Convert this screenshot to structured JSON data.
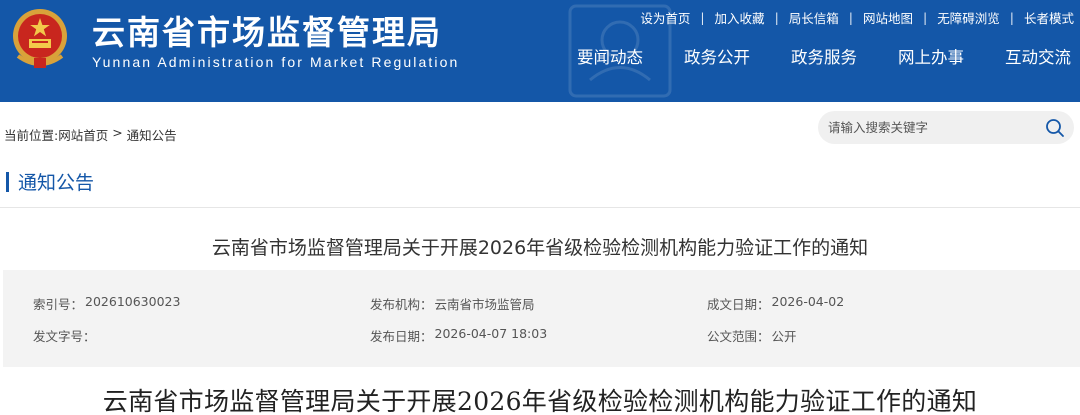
{
  "header": {
    "title": "云南省市场监督管理局",
    "subtitle": "Yunnan Administration for Market Regulation",
    "top_links": [
      "设为首页",
      "加入收藏",
      "局长信箱",
      "网站地图",
      "无障碍浏览",
      "长者模式"
    ],
    "nav": [
      "要闻动态",
      "政务公开",
      "政务服务",
      "网上办事",
      "互动交流"
    ],
    "brand_color": "#1457a8"
  },
  "breadcrumb": {
    "prefix": "当前位置: ",
    "home": "网站首页",
    "separator": " > ",
    "current": "通知公告"
  },
  "search": {
    "placeholder": "请输入搜索关键字",
    "icon": "search-icon"
  },
  "section": {
    "title": "通知公告"
  },
  "article": {
    "title": "云南省市场监督管理局关于开展2026年省级检验检测机构能力验证工作的通知",
    "meta": [
      {
        "label": "索引号：",
        "value": "202610630023"
      },
      {
        "label": "发布机构：",
        "value": "云南省市场监管局"
      },
      {
        "label": "成文日期：",
        "value": "2026-04-02"
      },
      {
        "label": "发文字号：",
        "value": ""
      },
      {
        "label": "发布日期：",
        "value": "2026-04-07 18:03"
      },
      {
        "label": "公文范围：",
        "value": "公开"
      }
    ],
    "body_title": "云南省市场监督管理局关于开展2026年省级检验检测机构能力验证工作的通知"
  }
}
